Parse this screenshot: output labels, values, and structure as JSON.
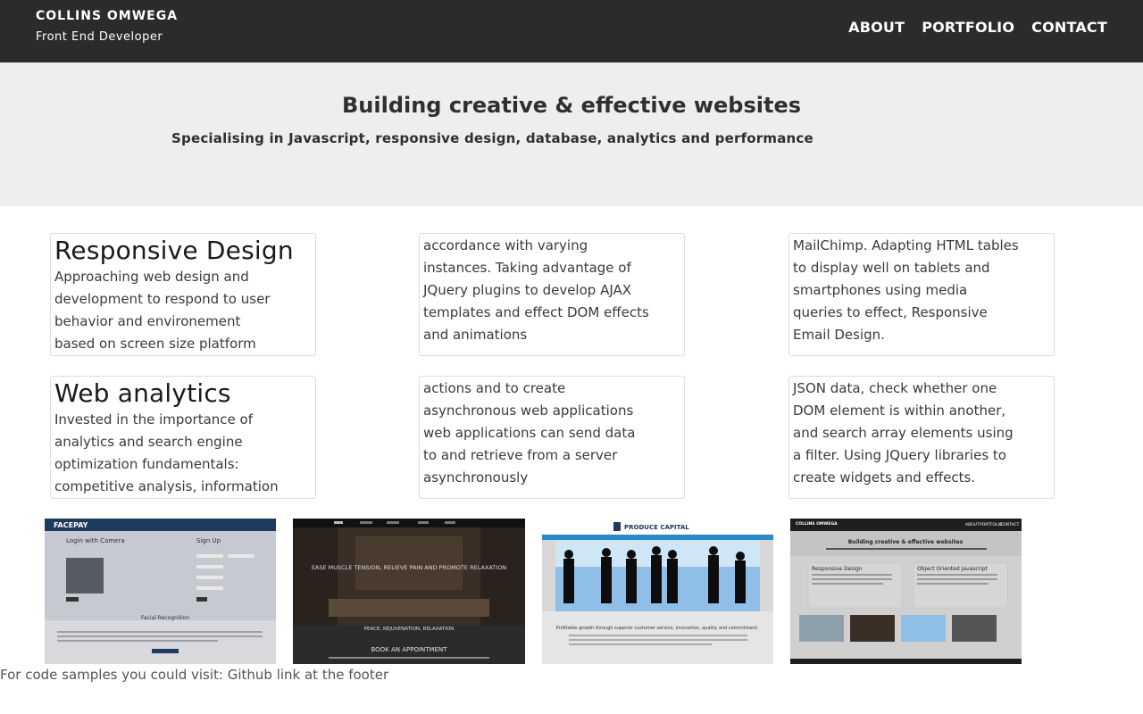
{
  "header": {
    "name": "COLLINS OMWEGA",
    "role": "Front End Developer",
    "nav": [
      "ABOUT",
      "PORTFOLIO",
      "CONTACT"
    ]
  },
  "hero": {
    "title": "Building creative & effective websites",
    "subtitle": "Specialising in Javascript, responsive design, database, analytics and performance"
  },
  "cards": [
    {
      "title": "Responsive Design",
      "lines": [
        "Approaching web design and",
        "development to respond to user",
        "behavior and environement",
        "based on screen size platform"
      ]
    },
    {
      "title": "",
      "lines": [
        "accordance with varying",
        "instances. Taking advantage of",
        "JQuery plugins to develop AJAX",
        "templates and effect DOM effects",
        "and animations"
      ]
    },
    {
      "title": "",
      "lines": [
        "MailChimp. Adapting HTML tables",
        "to display well on tablets and",
        "smartphones using media",
        "queries to effect, Responsive",
        "Email Design."
      ]
    },
    {
      "title": "Web analytics",
      "lines": [
        "Invested in the importance of",
        "analytics and search engine",
        "optimization fundamentals:",
        "competitive analysis, information"
      ]
    },
    {
      "title": "",
      "lines": [
        "actions and to create",
        "asynchronous web applications",
        "web applications can send data",
        "to and retrieve from a server",
        "asynchronously"
      ]
    },
    {
      "title": "",
      "lines": [
        "JSON data, check whether one",
        "DOM element is within another,",
        "and search array elements using",
        "a filter. Using JQuery libraries to",
        "create widgets and effects."
      ]
    }
  ],
  "thumbnails": [
    {
      "brand": "FACEPAY",
      "login_title": "Login with Camera",
      "signup_title": "Sign Up",
      "section_title": "Facial Recognition"
    },
    {
      "hero_text": "EASE MUSCLE TENSION, RELIEVE PAIN AND PROMOTE RELAXATION",
      "tagline": "PEACE, REJUVENATION, RELAXATION",
      "cta": "BOOK AN APPOINTMENT"
    },
    {
      "brand": "PRODUCE CAPITAL",
      "tagline": "Profitable growth through superior customer service, innovation, quality and commitment."
    },
    {
      "brand": "COLLINS OMWEGA",
      "nav": [
        "ABOUT",
        "PORTFOLIO",
        "CONTACT"
      ],
      "title": "Building creative & effective websites",
      "col1": "Responsive Design",
      "col2": "Object Oriented Javascript"
    }
  ],
  "footer_note": "For code samples you could visit: Github link at the footer"
}
